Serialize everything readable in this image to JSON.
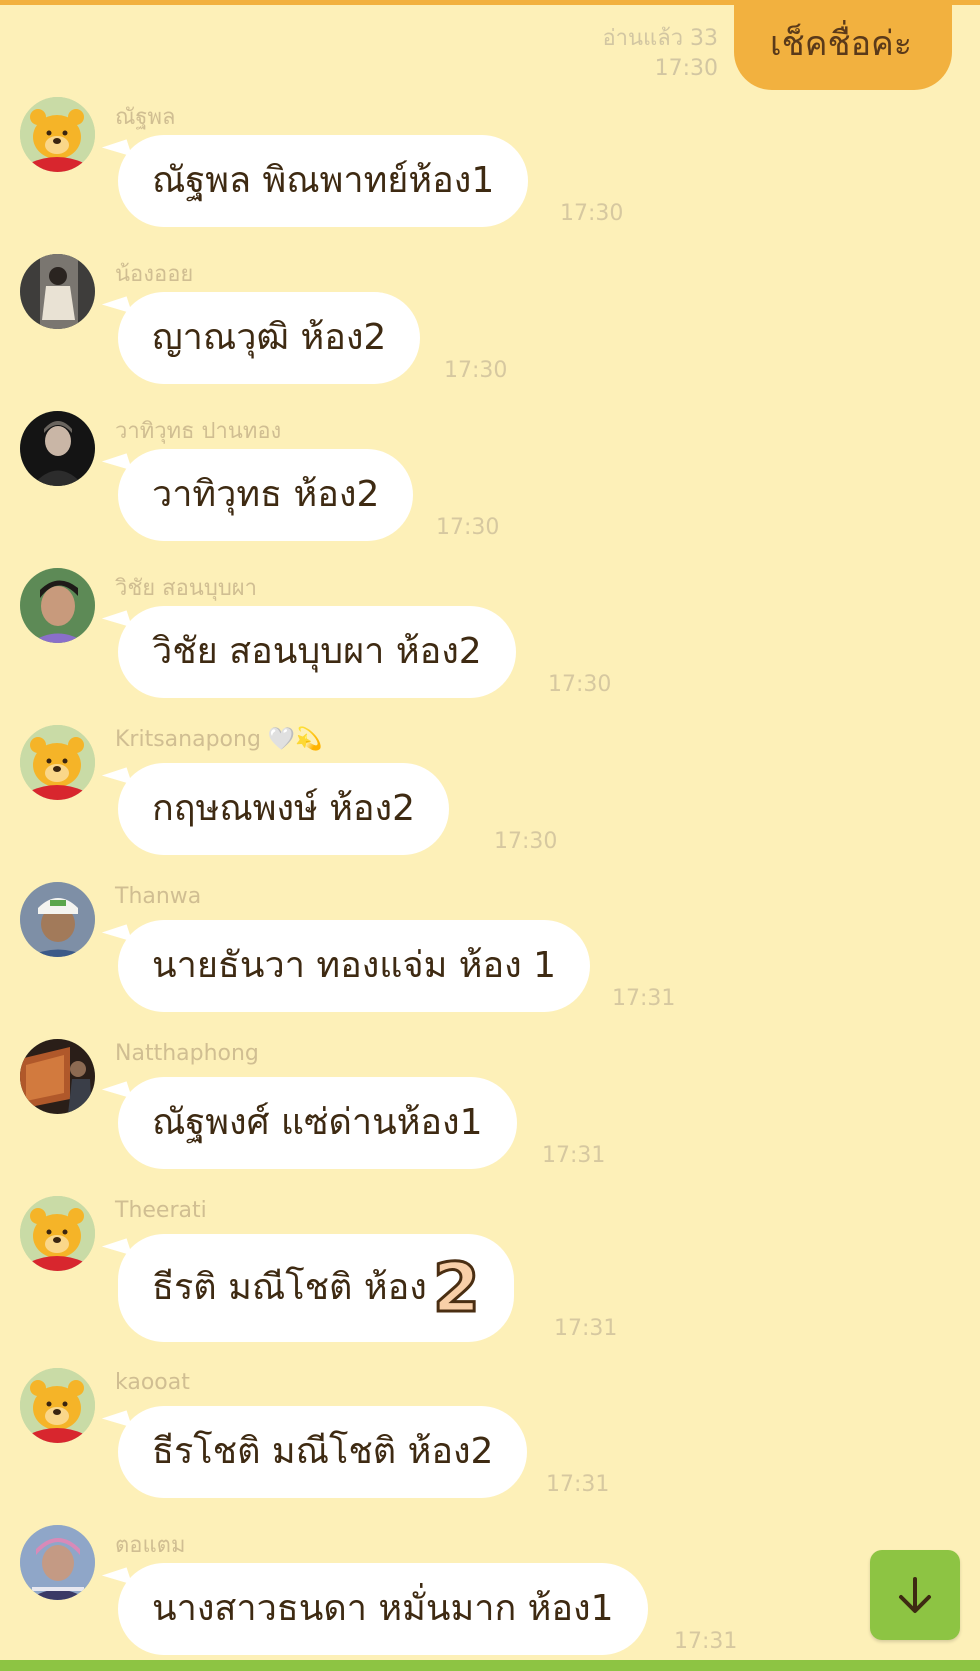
{
  "outgoing": {
    "read": "อ่านแล้ว 33",
    "time": "17:30",
    "text": "เช็คชื่อค่ะ"
  },
  "messages": [
    {
      "name": "ณัฐพล",
      "text": "ณัฐพล พิณพาทย์ห้อง1",
      "time": "17:30",
      "avatar": "pooh-icon"
    },
    {
      "name": "น้องออย",
      "text": "ญาณวุฒิ ห้อง2",
      "time": "17:30",
      "avatar": "photo-avatar"
    },
    {
      "name": "วาทิวุทธ  ปานทอง",
      "text": "วาทิวุทธ ห้อง2",
      "time": "17:30",
      "avatar": "photo-avatar"
    },
    {
      "name": "วิชัย   สอนบุบผา",
      "text": "วิชัย สอนบุบผา ห้อง2",
      "time": "17:30",
      "avatar": "photo-avatar"
    },
    {
      "name": "Kritsanapong 🤍💫",
      "text": "กฤษณพงษ์  ห้อง2",
      "time": "17:30",
      "avatar": "pooh-icon"
    },
    {
      "name": "Thanwa",
      "text": "นายธันวา ทองแจ่ม ห้อง 1",
      "time": "17:31",
      "avatar": "photo-avatar"
    },
    {
      "name": "Natthaphong",
      "text": "ณัฐพงศ์ แซ่ด่านห้อง1",
      "time": "17:31",
      "avatar": "photo-avatar"
    },
    {
      "name": "Theerati",
      "text": "ธีรติ มณีโชติ ห้อง",
      "emoji_text": "2",
      "time": "17:31",
      "avatar": "pooh-icon"
    },
    {
      "name": "kaooat",
      "text": "ธีรโชติ มณีโชติ ห้อง2",
      "time": "17:31",
      "avatar": "pooh-icon"
    },
    {
      "name": "ตอแตม",
      "text": "นางสาวธนดา หมั่นมาก ห้อง1",
      "time": "17:31",
      "avatar": "photo-avatar"
    }
  ],
  "colors": {
    "background": "#FDF0B8",
    "outgoing_bubble": "#F2B13F",
    "scroll_button": "#8DC443"
  },
  "scroll_button_icon": "arrow-down-icon"
}
